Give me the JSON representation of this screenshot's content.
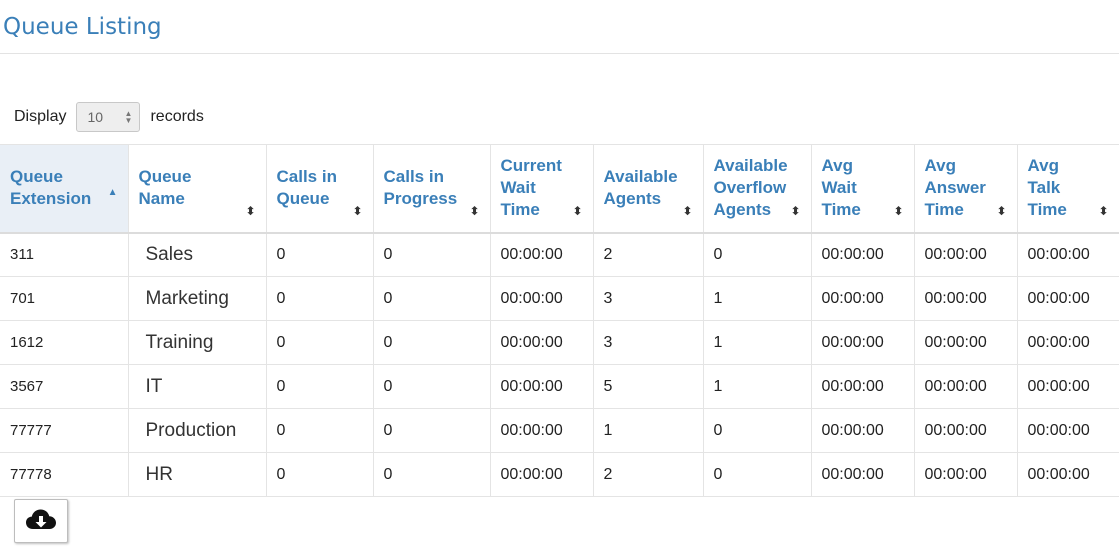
{
  "page": {
    "title": "Queue Listing"
  },
  "display": {
    "prefix": "Display",
    "value": "10",
    "suffix": "records"
  },
  "table": {
    "columns": [
      {
        "key": "ext",
        "label": "Queue Extension",
        "sorted": "asc"
      },
      {
        "key": "name",
        "label": "Queue Name"
      },
      {
        "key": "calls_in_queue",
        "label": "Calls in Queue"
      },
      {
        "key": "calls_in_progress",
        "label": "Calls in Progress"
      },
      {
        "key": "current_wait",
        "label": "Current Wait Time"
      },
      {
        "key": "available_agents",
        "label": "Available Agents"
      },
      {
        "key": "overflow_agents",
        "label": "Available Overflow Agents"
      },
      {
        "key": "avg_wait",
        "label": "Avg Wait Time"
      },
      {
        "key": "avg_answer",
        "label": "Avg Answer Time"
      },
      {
        "key": "avg_talk",
        "label": "Avg Talk Time"
      }
    ],
    "rows": [
      [
        "311",
        "Sales",
        "0",
        "0",
        "00:00:00",
        "2",
        "0",
        "00:00:00",
        "00:00:00",
        "00:00:00"
      ],
      [
        "701",
        "Marketing",
        "0",
        "0",
        "00:00:00",
        "3",
        "1",
        "00:00:00",
        "00:00:00",
        "00:00:00"
      ],
      [
        "1612",
        "Training",
        "0",
        "0",
        "00:00:00",
        "3",
        "1",
        "00:00:00",
        "00:00:00",
        "00:00:00"
      ],
      [
        "3567",
        "IT",
        "0",
        "0",
        "00:00:00",
        "5",
        "1",
        "00:00:00",
        "00:00:00",
        "00:00:00"
      ],
      [
        "77777",
        "Production",
        "0",
        "0",
        "00:00:00",
        "1",
        "0",
        "00:00:00",
        "00:00:00",
        "00:00:00"
      ],
      [
        "77778",
        "HR",
        "0",
        "0",
        "00:00:00",
        "2",
        "0",
        "00:00:00",
        "00:00:00",
        "00:00:00"
      ]
    ]
  },
  "export_button": {
    "icon": "cloud-download-icon"
  }
}
